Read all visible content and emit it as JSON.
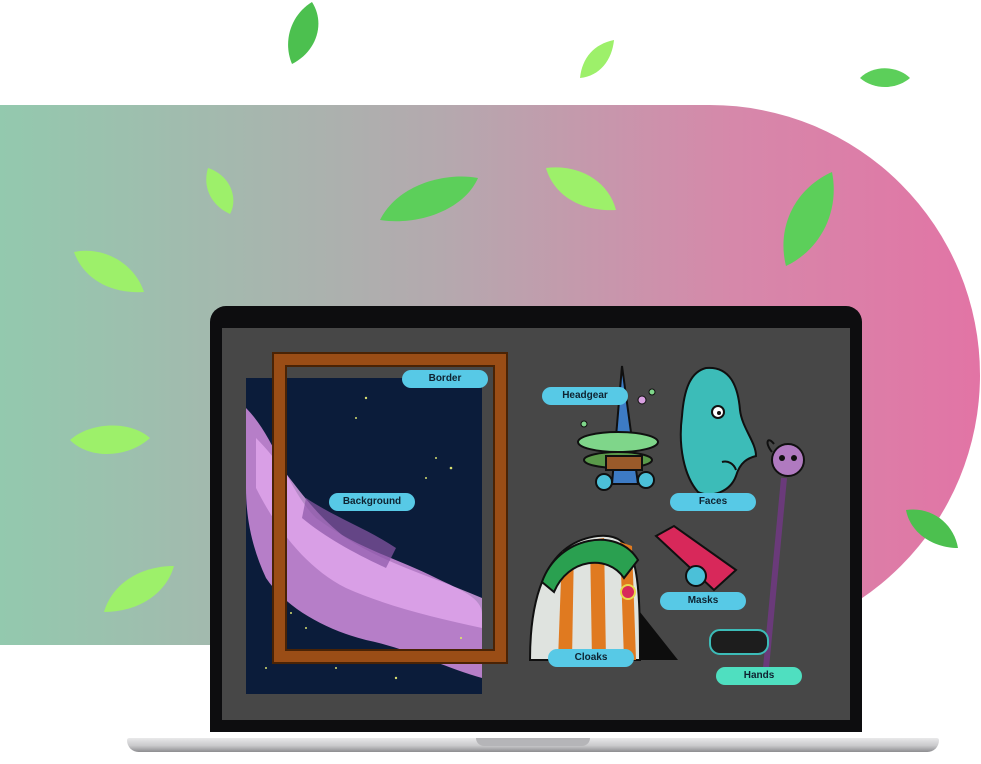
{
  "labels": {
    "border": "Border",
    "background": "Background",
    "headgear": "Headgear",
    "faces": "Faces",
    "masks": "Masks",
    "cloaks": "Cloaks",
    "hands": "Hands"
  },
  "colors": {
    "gradient_start": "#93c9ae",
    "gradient_end": "#e274a5",
    "leaf_green": "#5ccf5a",
    "leaf_light": "#9df06a",
    "screen": "#474747",
    "tag_blue": "#57c9e6",
    "tag_green": "#4fdfc0"
  }
}
